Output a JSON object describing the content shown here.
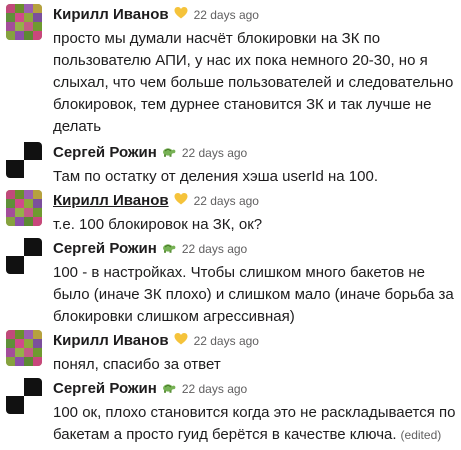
{
  "messages": [
    {
      "author": "Кирилл Иванов",
      "status_icon": "yellow-heart-icon",
      "timestamp": "22 days ago",
      "text": "просто мы думали насчёт блокировки на ЗК по пользователю АПИ, у нас их пока немного 20-30, но я слыхал, что чем больше пользователей и следовательно блокировок, тем дурнее становится ЗК и так лучше не делать"
    },
    {
      "author": "Сергей Рожин",
      "status_icon": "turtle-icon",
      "timestamp": "22 days ago",
      "text": "Там по остатку от деления хэша userId на 100."
    },
    {
      "author": "Кирилл Иванов",
      "status_icon": "yellow-heart-icon",
      "timestamp": "22 days ago",
      "text": "т.е. 100 блокировок на ЗК, ок?"
    },
    {
      "author": "Сергей Рожин",
      "status_icon": "turtle-icon",
      "timestamp": "22 days ago",
      "text": "100 - в настройках. Чтобы слишком много бакетов не было (иначе ЗК плохо) и слишком мало (иначе борьба за блокировки слишком агрессивная)"
    },
    {
      "author": "Кирилл Иванов",
      "status_icon": "yellow-heart-icon",
      "timestamp": "22 days ago",
      "text": "понял, спасибо за ответ"
    },
    {
      "author": "Сергей Рожин",
      "status_icon": "turtle-icon",
      "timestamp": "22 days ago",
      "text": "100 ок, плохо становится когда это не раскладывается по бакетам а просто гуид берётся в качестве ключа.",
      "edited": "(edited)"
    }
  ],
  "colors": {
    "text": "#1d1c1d",
    "muted": "#616061",
    "heart": "#f5c33b",
    "turtle": "#77b255"
  }
}
